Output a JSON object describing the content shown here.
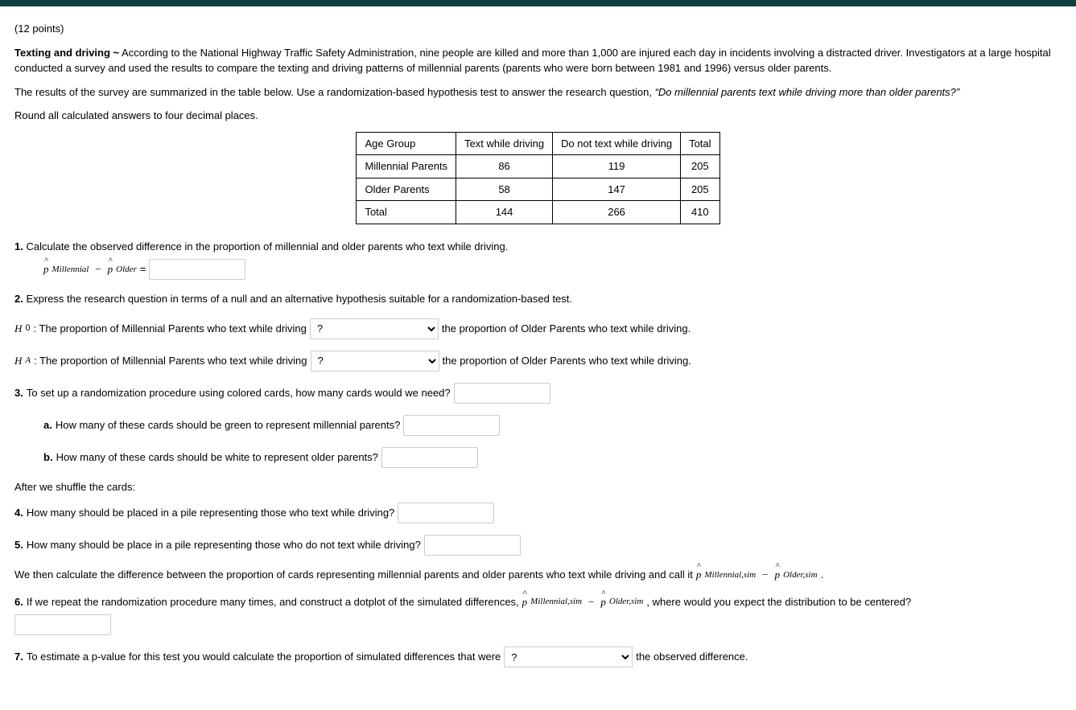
{
  "header": {
    "points": "(12 points)",
    "title": "Texting and driving ~",
    "intro1": "According to the National Highway Traffic Safety Administration, nine people are killed and more than 1,000 are injured each day in incidents involving a distracted driver. Investigators at a large hospital conducted a survey and used the results to compare the texting and driving patterns of millennial parents (parents who were born between 1981 and 1996) versus older parents.",
    "intro2a": "The results of the survey are summarized in the table below. Use a randomization-based hypothesis test to answer the research question, ",
    "intro2b": "“Do millennial parents text while driving more than older parents?”",
    "intro3": "Round all calculated answers to four decimal places."
  },
  "table": {
    "headers": [
      "Age Group",
      "Text while driving",
      "Do not text while driving",
      "Total"
    ],
    "rows": [
      [
        "Millennial Parents",
        "86",
        "119",
        "205"
      ],
      [
        "Older Parents",
        "58",
        "147",
        "205"
      ],
      [
        "Total",
        "144",
        "266",
        "410"
      ]
    ]
  },
  "q1": {
    "num": "1.",
    "text": "Calculate the observed difference in the proportion of millennial and older parents who text while driving.",
    "p1": "p",
    "sub1": "Millennial",
    "minus": "−",
    "p2": "p",
    "sub2": "Older",
    "eq": "="
  },
  "q2": {
    "num": "2.",
    "text": "Express the research question in terms of a null and an alternative hypothesis suitable for a randomization-based test.",
    "h0": "H",
    "h0s": "0",
    "ha": "H",
    "has": "A",
    "lead": ": The proportion of Millennial Parents who text while driving",
    "tail": "the proportion of Older Parents who text while driving.",
    "sel": "?"
  },
  "q3": {
    "num": "3.",
    "text": "To set up a randomization procedure using colored cards, how many cards would we need?",
    "a_num": "a.",
    "a": "How many of these cards should be green to represent millennial parents?",
    "b_num": "b.",
    "b": "How many of these cards should be white to represent older parents?"
  },
  "shuffle": "After we shuffle the cards:",
  "q4": {
    "num": "4.",
    "text": "How many should be placed in a pile representing those who text while driving?"
  },
  "q5": {
    "num": "5.",
    "text": "How many should be place in a pile representing those who do not text while driving?"
  },
  "calc": {
    "a": "We then calculate the difference between the proportion of cards representing millennial parents and older parents who text while driving and call it ",
    "p1": "p",
    "s1": "Millennial,sim",
    "m": "−",
    "p2": "p",
    "s2": "Older,sim",
    "dot": "."
  },
  "q6": {
    "num": "6.",
    "a": "If we repeat the randomization procedure many times, and construct a dotplot of the simulated differences, ",
    "p1": "p",
    "s1": "Millennial,sim",
    "m": "−",
    "p2": "p",
    "s2": "Older,sim",
    "b": ", where would you expect the distribution to be centered?"
  },
  "q7": {
    "num": "7.",
    "a": "To estimate a p-value for this test you would calculate the proportion of simulated differences that were",
    "sel": "?",
    "b": "the observed difference."
  }
}
